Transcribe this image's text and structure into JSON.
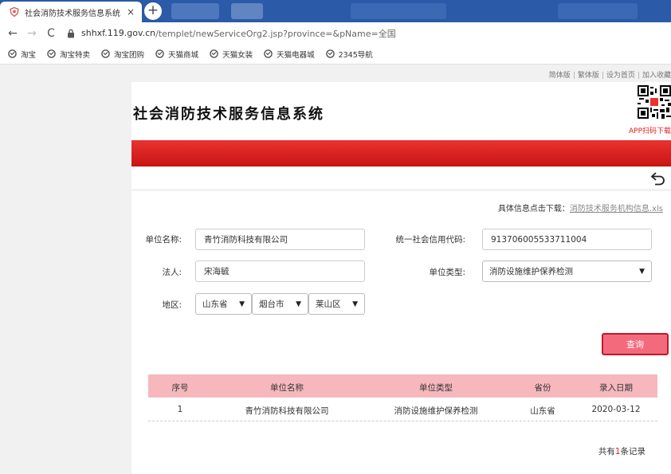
{
  "browser": {
    "tab_title": "社会消防技术服务信息系统",
    "tab_close": "×",
    "new_tab": "+",
    "url_host": "shhxf.119.gov.cn",
    "url_path": "/templet/newServiceOrg2.jsp?province=&pName=全国",
    "nav": {
      "back": "←",
      "forward": "→",
      "reload": "C"
    },
    "bookmarks": [
      "淘宝",
      "淘宝特卖",
      "淘宝团购",
      "天猫商城",
      "天猫女装",
      "天猫电器城",
      "2345导航"
    ]
  },
  "site": {
    "toplinks": [
      "简体版",
      "繁体版",
      "设为首页",
      "加入收藏"
    ],
    "toplink_sep": "|",
    "title": "社会消防技术服务信息系统",
    "qr_label": "APP扫码下载",
    "brand_red": "#d21c1c"
  },
  "download": {
    "prefix": "具体信息点击下载：",
    "link": "消防技术服务机构信息.xls"
  },
  "form": {
    "unit_name_label": "单位名称:",
    "unit_name_value": "青竹消防科技有限公司",
    "credit_code_label": "统一社会信用代码:",
    "credit_code_value": "913706005533711004",
    "legal_label": "法人:",
    "legal_value": "宋海毓",
    "unit_type_label": "单位类型:",
    "unit_type_value": "消防设施维护保养检测",
    "region_label": "地区:",
    "province": "山东省",
    "city": "烟台市",
    "district": "莱山区",
    "query_button": "查询"
  },
  "table": {
    "headers": [
      "序号",
      "单位名称",
      "单位类型",
      "省份",
      "录入日期"
    ],
    "rows": [
      [
        "1",
        "青竹消防科技有限公司",
        "消防设施维护保养检测",
        "山东省",
        "2020-03-12"
      ]
    ]
  },
  "pager": {
    "prefix": "共有",
    "count": "1",
    "suffix": "条记录"
  }
}
